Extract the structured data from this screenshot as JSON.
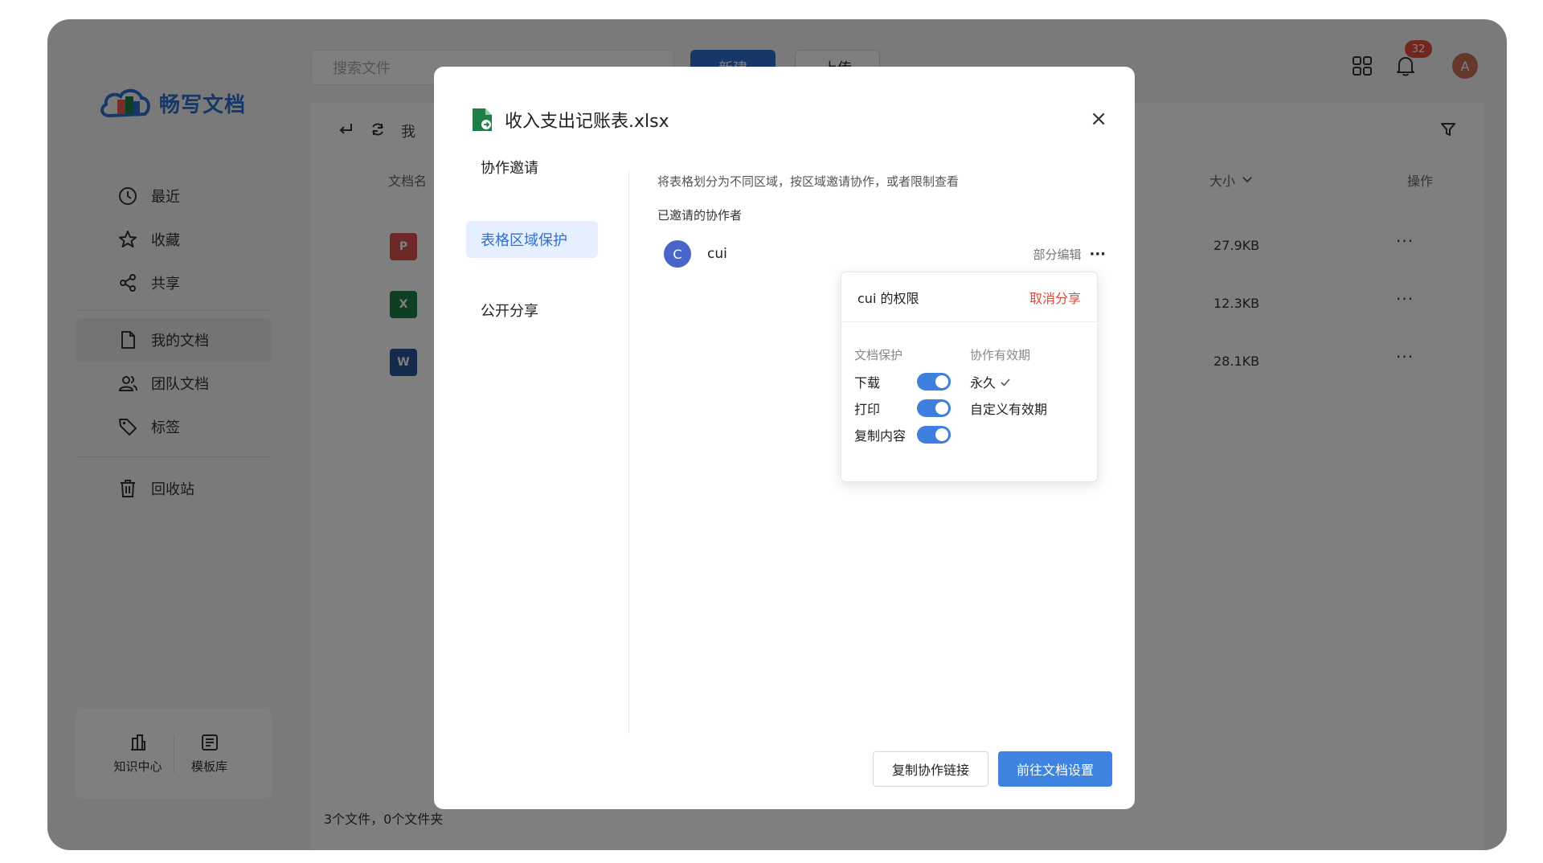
{
  "app": {
    "logo_text": "畅写文档",
    "search_placeholder": "搜索文件",
    "new_label": "新建",
    "upload_label": "上传",
    "notification_count": "32",
    "avatar_letter": "A"
  },
  "sidebar": {
    "items": [
      {
        "label": "最近",
        "icon": "clock-icon"
      },
      {
        "label": "收藏",
        "icon": "star-icon"
      },
      {
        "label": "共享",
        "icon": "share-icon"
      },
      {
        "label": "我的文档",
        "icon": "document-icon"
      },
      {
        "label": "团队文档",
        "icon": "team-icon"
      },
      {
        "label": "标签",
        "icon": "tag-icon"
      },
      {
        "label": "回收站",
        "icon": "trash-icon"
      }
    ],
    "bottom": [
      {
        "label": "知识中心",
        "icon": "knowledge-icon"
      },
      {
        "label": "模板库",
        "icon": "template-icon"
      }
    ]
  },
  "file_list": {
    "breadcrumb": "我",
    "col_name": "文档名",
    "col_size": "大小",
    "col_actions": "操作",
    "rows": [
      {
        "type": "pdf",
        "glyph": "P",
        "size": "27.9KB"
      },
      {
        "type": "xlsx",
        "glyph": "X",
        "size": "12.3KB"
      },
      {
        "type": "docx",
        "glyph": "W",
        "size": "28.1KB"
      }
    ],
    "more_glyph": "···",
    "footer": "3个文件，0个文件夹"
  },
  "modal": {
    "title": "收入支出记账表.xlsx",
    "close_glyph": "×",
    "tabs": [
      "协作邀请",
      "表格区域保护",
      "公开分享"
    ],
    "active_tab": 1,
    "description": "将表格划分为不同区域，按区域邀请协作，或者限制查看",
    "invited_label": "已邀请的协作者",
    "collaborator": {
      "avatar_letter": "C",
      "name": "cui",
      "role": "部分编辑",
      "more_glyph": "···"
    },
    "permissions": {
      "title": "cui 的权限",
      "cancel_share": "取消分享",
      "protection_title": "文档保护",
      "protection_items": [
        {
          "label": "下载",
          "enabled": true
        },
        {
          "label": "打印",
          "enabled": true
        },
        {
          "label": "复制内容",
          "enabled": true
        }
      ],
      "validity_title": "协作有效期",
      "validity_options": [
        {
          "label": "永久",
          "selected": true
        },
        {
          "label": "自定义有效期",
          "selected": false
        }
      ]
    },
    "copy_link_label": "复制协作链接",
    "go_settings_label": "前往文档设置"
  },
  "colors": {
    "accent": "#2f6fd0",
    "button_primary": "#3f83e0",
    "danger": "#e0473a",
    "pdf": "#d9534f",
    "xlsx": "#1e7e45",
    "docx": "#2b579a"
  }
}
